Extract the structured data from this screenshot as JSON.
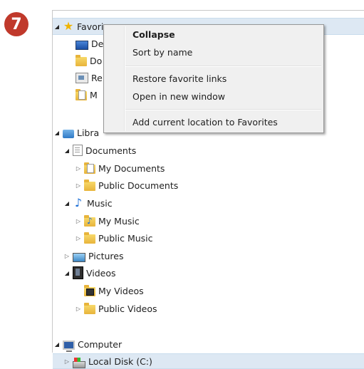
{
  "step_badge": "7",
  "tree": {
    "favorites": {
      "label": "Favorites",
      "visible_label": "Favori"
    },
    "favorite_items": [
      {
        "label": "De"
      },
      {
        "label": "Do"
      },
      {
        "label": "Re"
      },
      {
        "label": "M"
      }
    ],
    "libraries": {
      "label": "Libraries",
      "visible_label": "Libra"
    },
    "documents": {
      "label": "Documents"
    },
    "my_documents": {
      "label": "My Documents"
    },
    "public_documents": {
      "label": "Public Documents"
    },
    "music": {
      "label": "Music"
    },
    "my_music": {
      "label": "My Music"
    },
    "public_music": {
      "label": "Public Music"
    },
    "pictures": {
      "label": "Pictures"
    },
    "videos": {
      "label": "Videos"
    },
    "my_videos": {
      "label": "My Videos"
    },
    "public_videos": {
      "label": "Public Videos"
    },
    "computer": {
      "label": "Computer"
    },
    "local_disk": {
      "label": "Local Disk (C:)"
    }
  },
  "context_menu": {
    "items": [
      {
        "label": "Collapse",
        "default": true
      },
      {
        "label": "Sort by name"
      },
      {
        "label": "Restore favorite links"
      },
      {
        "label": "Open in new window"
      },
      {
        "label": "Add current location to Favorites"
      }
    ]
  },
  "icons": {
    "expanded": "triangle-down",
    "collapsed": "triangle-right"
  },
  "colors": {
    "badge": "#c0392b",
    "selection": "#dde8f3",
    "menu_background": "#f0f0f0"
  }
}
